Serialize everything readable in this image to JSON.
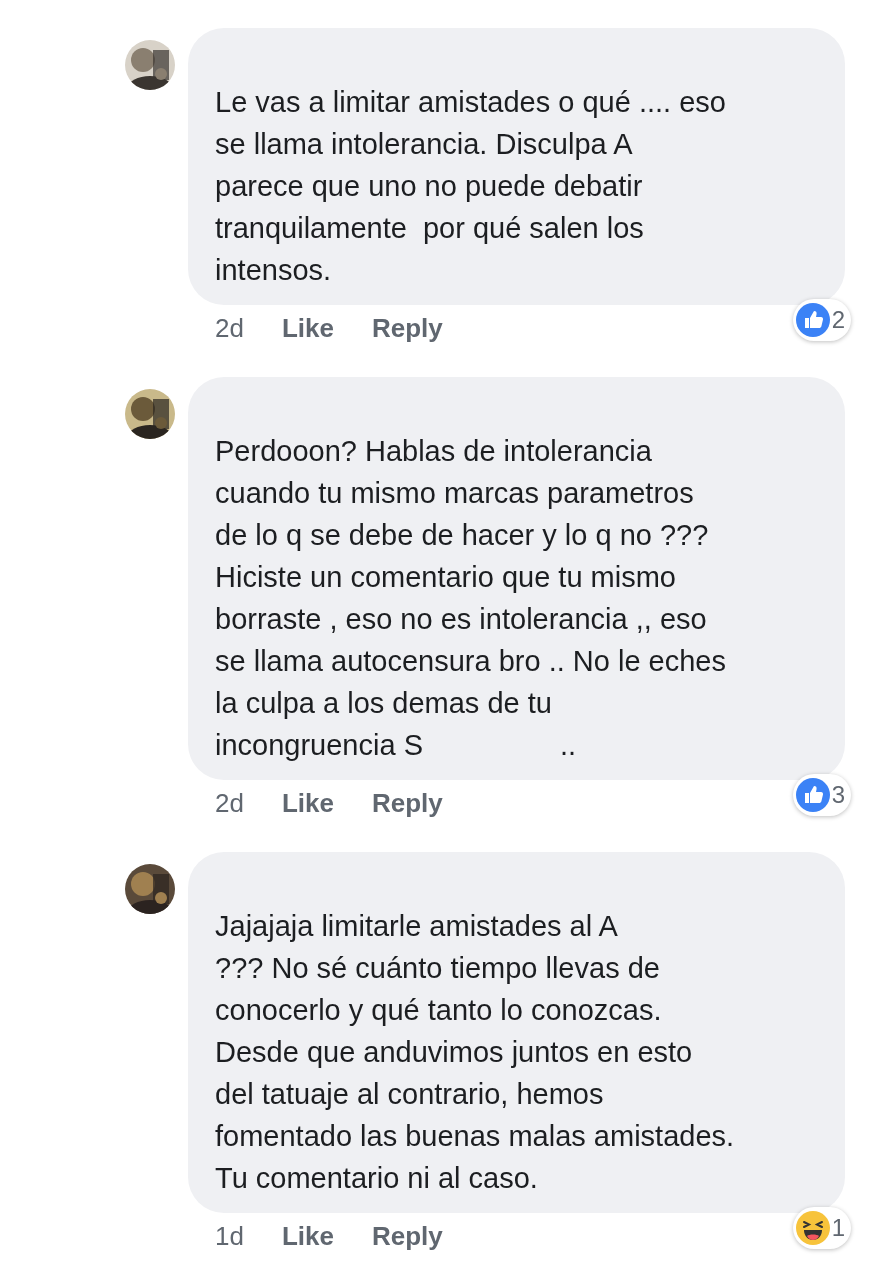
{
  "comments": [
    {
      "body_lines": [
        "Le vas a limitar amistades o qué .... eso",
        "se llama intolerancia. Disculpa A",
        "parece que uno no puede debatir",
        "tranquilamente  por qué salen los",
        "intensos."
      ],
      "time": "2d",
      "actions": [
        "Like",
        "Reply"
      ],
      "reaction": {
        "kind": "like",
        "count": "2"
      }
    },
    {
      "body_lines": [
        "Perdooon? Hablas de intolerancia",
        "cuando tu mismo marcas parametros",
        "de lo q se debe de hacer y lo q no ???",
        "Hiciste un comentario que tu mismo",
        "borraste , eso no es intolerancia ,, eso",
        "se llama autocensura bro .. No le eches",
        "la culpa a los demas de tu",
        "incongruencia S                 .."
      ],
      "time": "2d",
      "actions": [
        "Like",
        "Reply"
      ],
      "reaction": {
        "kind": "like",
        "count": "3"
      }
    },
    {
      "body_lines": [
        "Jajajaja limitarle amistades al A",
        "??? No sé cuánto tiempo llevas de",
        "conocerlo y qué tanto lo conozcas.",
        "Desde que anduvimos juntos en esto",
        "del tatuaje al contrario, hemos",
        "fomentado las buenas malas amistades.",
        "Tu comentario ni al caso."
      ],
      "time": "1d",
      "actions": [
        "Like",
        "Reply"
      ],
      "reaction": {
        "kind": "haha",
        "count": "1"
      }
    }
  ]
}
